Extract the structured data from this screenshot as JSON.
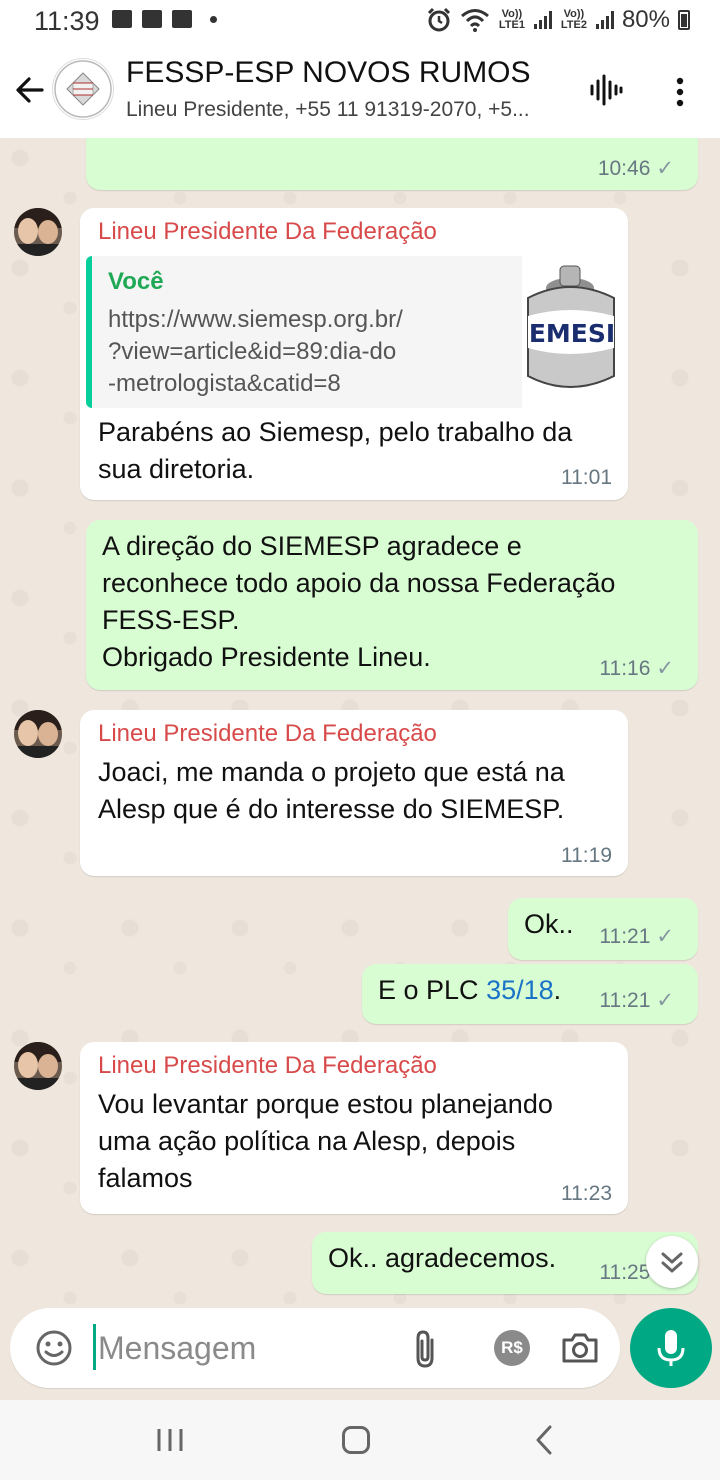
{
  "status_bar": {
    "time": "11:39",
    "lte1_label": "Vo)) LTE1",
    "lte2_label": "Vo)) LTE2",
    "battery": "80%"
  },
  "header": {
    "title": "FESSP-ESP NOVOS RUMOS",
    "subtitle": "Lineu Presidente, +55 11 91319-2070, +5..."
  },
  "messages": [
    {
      "type": "out",
      "time": "10:46"
    },
    {
      "type": "in",
      "sender": "Lineu Presidente Da Federação",
      "quote_author": "Você",
      "quote_text": "https://www.siemesp.org.br/\n?view=article&id=89:dia-do\n-metrologista&catid=8",
      "quote_thumb_text": "EMESI",
      "text": "Parabéns ao Siemesp, pelo trabalho da\nsua diretoria.",
      "time": "11:01"
    },
    {
      "type": "out",
      "text": "A direção do SIEMESP agradece e\nreconhece todo apoio da nossa Federação\nFESS-ESP.\nObrigado Presidente Lineu.",
      "time": "11:16"
    },
    {
      "type": "in",
      "sender": "Lineu Presidente Da Federação",
      "text": "Joaci, me manda o projeto que está na\nAlesp  que é do interesse do SIEMESP.",
      "time": "11:19"
    },
    {
      "type": "out",
      "text": "Ok..",
      "time": "11:21"
    },
    {
      "type": "out",
      "text_prefix": "E o PLC ",
      "link_text": "35/18",
      "text_suffix": ".",
      "time": "11:21"
    },
    {
      "type": "in",
      "sender": "Lineu Presidente Da Federação",
      "text": "Vou levantar porque estou planejando\numa ação política na Alesp, depois\nfalamos",
      "time": "11:23"
    },
    {
      "type": "out",
      "text": "Ok.. agradecemos.",
      "time": "11:25"
    }
  ],
  "input": {
    "placeholder": "Mensagem",
    "pay_label": "R$"
  },
  "colors": {
    "accent": "#00a884",
    "sender_name": "#d84a4a",
    "outgoing_bubble": "#d9fdd3",
    "incoming_bubble": "#ffffff",
    "chat_background": "#efe7dd",
    "link": "#1a73c7"
  },
  "icons": [
    "back-arrow-icon",
    "voice-call-icon",
    "menu-icon",
    "emoji-icon",
    "attach-icon",
    "payment-icon",
    "camera-icon",
    "mic-icon",
    "scroll-down-icon",
    "tick-icon"
  ]
}
